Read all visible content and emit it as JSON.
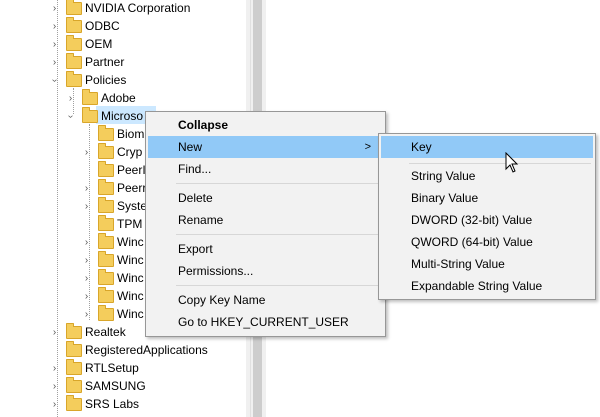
{
  "tree": {
    "items": [
      {
        "label": "NVIDIA Corporation"
      },
      {
        "label": "ODBC"
      },
      {
        "label": "OEM"
      },
      {
        "label": "Partner"
      },
      {
        "label": "Policies"
      },
      {
        "label": "Adobe"
      },
      {
        "label": "Microso"
      },
      {
        "label": "Biom"
      },
      {
        "label": "Cryp"
      },
      {
        "label": "PeerI"
      },
      {
        "label": "Peerr"
      },
      {
        "label": "Syste"
      },
      {
        "label": "TPM"
      },
      {
        "label": "Winc"
      },
      {
        "label": "Winc"
      },
      {
        "label": "Winc"
      },
      {
        "label": "Winc"
      },
      {
        "label": "Winc"
      },
      {
        "label": "Realtek"
      },
      {
        "label": "RegisteredApplications"
      },
      {
        "label": "RTLSetup"
      },
      {
        "label": "SAMSUNG"
      },
      {
        "label": "SRS Labs"
      }
    ]
  },
  "context_menu": {
    "collapse": "Collapse",
    "new": "New",
    "new_arrow": ">",
    "find": "Find...",
    "delete": "Delete",
    "rename": "Rename",
    "export": "Export",
    "permissions": "Permissions...",
    "copy_key_name": "Copy Key Name",
    "goto_hkcu": "Go to HKEY_CURRENT_USER"
  },
  "submenu": {
    "key": "Key",
    "string_value": "String Value",
    "binary_value": "Binary Value",
    "dword_value": "DWORD (32-bit) Value",
    "qword_value": "QWORD (64-bit) Value",
    "multi_string_value": "Multi-String Value",
    "expandable_string_value": "Expandable String Value"
  },
  "colors": {
    "highlight": "#91c9f7",
    "selected_tree": "#cce8ff",
    "folder": "#f4cd5c",
    "menu_bg": "#f2f2f2"
  }
}
